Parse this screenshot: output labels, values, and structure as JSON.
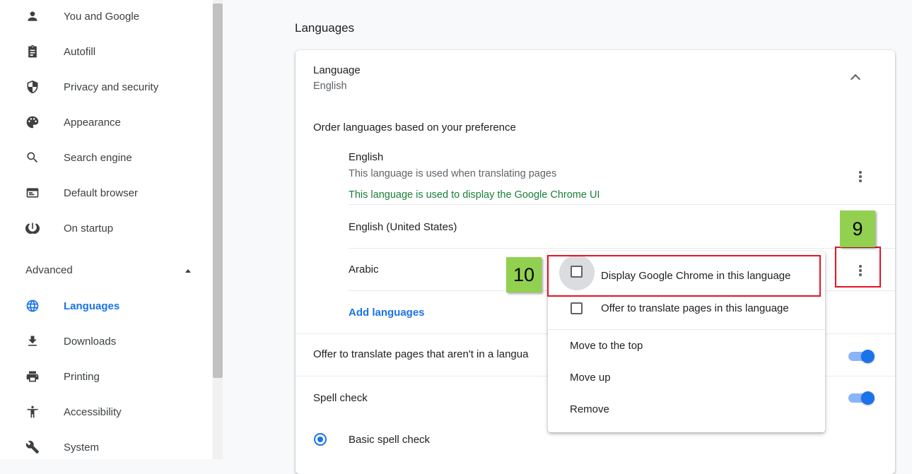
{
  "sidebar": {
    "items": [
      {
        "label": "You and Google",
        "icon": "person-icon"
      },
      {
        "label": "Autofill",
        "icon": "clipboard-icon"
      },
      {
        "label": "Privacy and security",
        "icon": "shield-icon"
      },
      {
        "label": "Appearance",
        "icon": "palette-icon"
      },
      {
        "label": "Search engine",
        "icon": "search-icon"
      },
      {
        "label": "Default browser",
        "icon": "browser-icon"
      },
      {
        "label": "On startup",
        "icon": "power-icon"
      }
    ],
    "advanced_label": "Advanced",
    "advanced_items": [
      {
        "label": "Languages",
        "icon": "globe-icon",
        "active": true
      },
      {
        "label": "Downloads",
        "icon": "download-icon"
      },
      {
        "label": "Printing",
        "icon": "printer-icon"
      },
      {
        "label": "Accessibility",
        "icon": "accessibility-icon"
      },
      {
        "label": "System",
        "icon": "wrench-icon"
      }
    ]
  },
  "main": {
    "section_title": "Languages",
    "language": {
      "title": "Language",
      "value": "English"
    },
    "order_heading": "Order languages based on your preference",
    "languages": [
      {
        "name": "English",
        "note": "This language is used when translating pages",
        "ui_note": "This language is used to display the Google Chrome UI"
      },
      {
        "name": "English (United States)"
      },
      {
        "name": "Arabic"
      }
    ],
    "add_languages": "Add languages",
    "offer_translate": "Offer to translate pages that aren't in a langua",
    "spell_check": "Spell check",
    "basic_spell_check": "Basic spell check"
  },
  "menu": {
    "items": [
      "Display Google Chrome in this language",
      "Offer to translate pages in this language",
      "Move to the top",
      "Move up",
      "Remove"
    ]
  },
  "annotations": {
    "label_9": "9",
    "label_10": "10"
  },
  "colors": {
    "accent": "#1a73e8",
    "green_text": "#188038",
    "annotation_label": "#92d050",
    "annotation_box": "#e81123"
  }
}
